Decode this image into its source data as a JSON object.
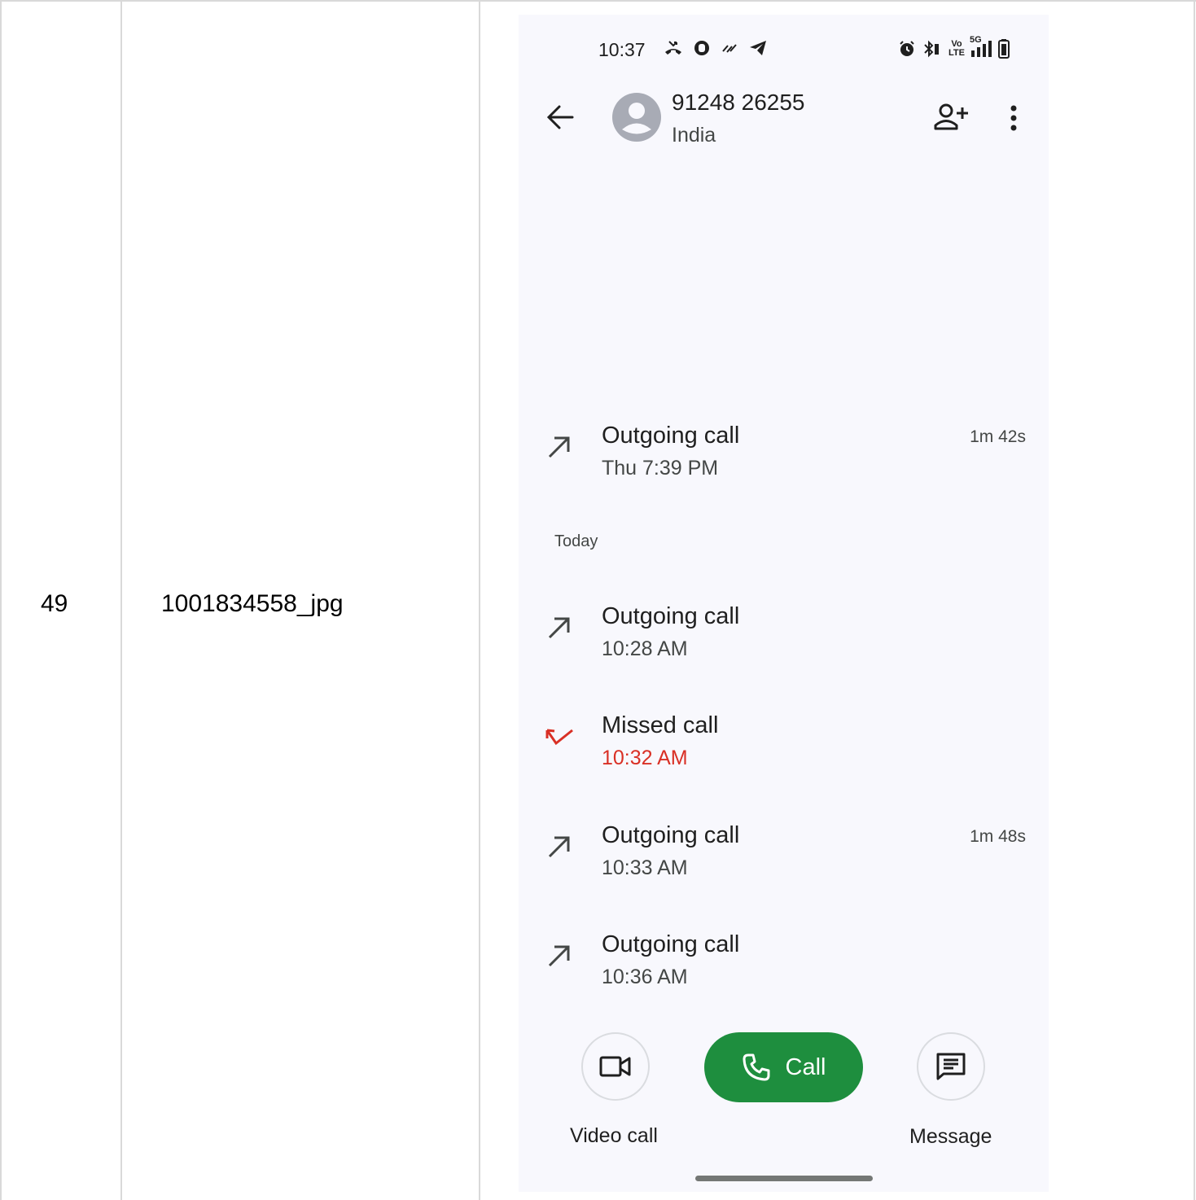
{
  "table_row": {
    "index": "49",
    "filename": "1001834558_jpg"
  },
  "status_bar": {
    "time": "10:37",
    "volte_top": "Vo",
    "volte_bottom": "LTE",
    "network": "5G"
  },
  "contact": {
    "number": "91248 26255",
    "country": "India"
  },
  "calls_before": [
    {
      "type": "Outgoing call",
      "time": "Thu 7:39 PM",
      "duration": "1m 42s"
    }
  ],
  "section_today": "Today",
  "calls_today": [
    {
      "type": "Outgoing call",
      "time": "10:28 AM",
      "duration": ""
    },
    {
      "type": "Missed call",
      "time": "10:32 AM",
      "duration": ""
    },
    {
      "type": "Outgoing call",
      "time": "10:33 AM",
      "duration": "1m 48s"
    },
    {
      "type": "Outgoing call",
      "time": "10:36 AM",
      "duration": ""
    }
  ],
  "actions": {
    "video_call": "Video call",
    "call": "Call",
    "message": "Message"
  },
  "colors": {
    "call_green": "#1e8e3e",
    "missed_red": "#d93025",
    "background": "#f8f8fd"
  }
}
